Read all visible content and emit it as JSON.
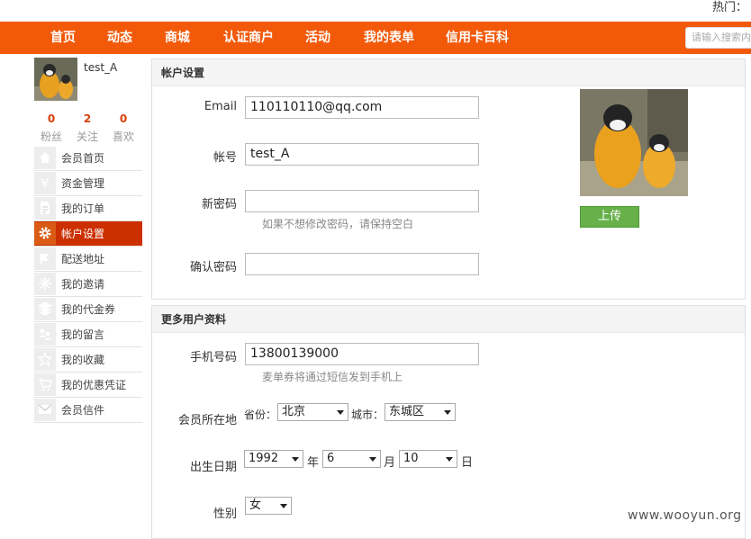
{
  "header": {
    "hot_label": "热门："
  },
  "nav": {
    "items": [
      "首页",
      "动态",
      "商城",
      "认证商户",
      "活动",
      "我的表单",
      "信用卡百科"
    ],
    "search_placeholder": "请输入搜索内容"
  },
  "profile": {
    "username": "test_A",
    "stats": [
      {
        "num": "0",
        "label": "粉丝"
      },
      {
        "num": "2",
        "label": "关注"
      },
      {
        "num": "0",
        "label": "喜欢"
      }
    ]
  },
  "sidebar": {
    "items": [
      {
        "label": "会员首页",
        "icon": "home-icon"
      },
      {
        "label": "资金管理",
        "icon": "yen-icon"
      },
      {
        "label": "我的订单",
        "icon": "document-icon"
      },
      {
        "label": "帐户设置",
        "icon": "gear-icon"
      },
      {
        "label": "配送地址",
        "icon": "flag-icon"
      },
      {
        "label": "我的邀请",
        "icon": "sparkle-icon"
      },
      {
        "label": "我的代金券",
        "icon": "stack-icon"
      },
      {
        "label": "我的留言",
        "icon": "users-icon"
      },
      {
        "label": "我的收藏",
        "icon": "star-icon"
      },
      {
        "label": "我的优惠凭证",
        "icon": "cart-icon"
      },
      {
        "label": "会员信件",
        "icon": "mail-icon"
      }
    ],
    "active_index": 3
  },
  "account": {
    "title": "帐户设置",
    "email_label": "Email",
    "email_value": "110110110@qq.com",
    "account_label": "帐号",
    "account_value": "test_A",
    "new_pw_label": "新密码",
    "new_pw_value": "",
    "new_pw_hint": "如果不想修改密码，请保持空白",
    "confirm_pw_label": "确认密码",
    "confirm_pw_value": "",
    "upload_label": "上传"
  },
  "more": {
    "title": "更多用户资料",
    "phone_label": "手机号码",
    "phone_value": "13800139000",
    "phone_hint": "麦单券将通过短信发到手机上",
    "location_label": "会员所在地",
    "province_label": "省份：",
    "province_value": "北京",
    "city_label": "城市：",
    "city_value": "东城区",
    "birth_label": "出生日期",
    "year_value": "1992",
    "year_unit": "年",
    "month_value": "6",
    "month_unit": "月",
    "day_value": "10",
    "day_unit": "日",
    "gender_label": "性别",
    "gender_value": "女"
  },
  "watermark": "www.wooyun.org",
  "colors": {
    "nav": "#f25a0a",
    "active": "#cc2f00",
    "upload": "#67b04a",
    "stat": "#d6400c"
  }
}
